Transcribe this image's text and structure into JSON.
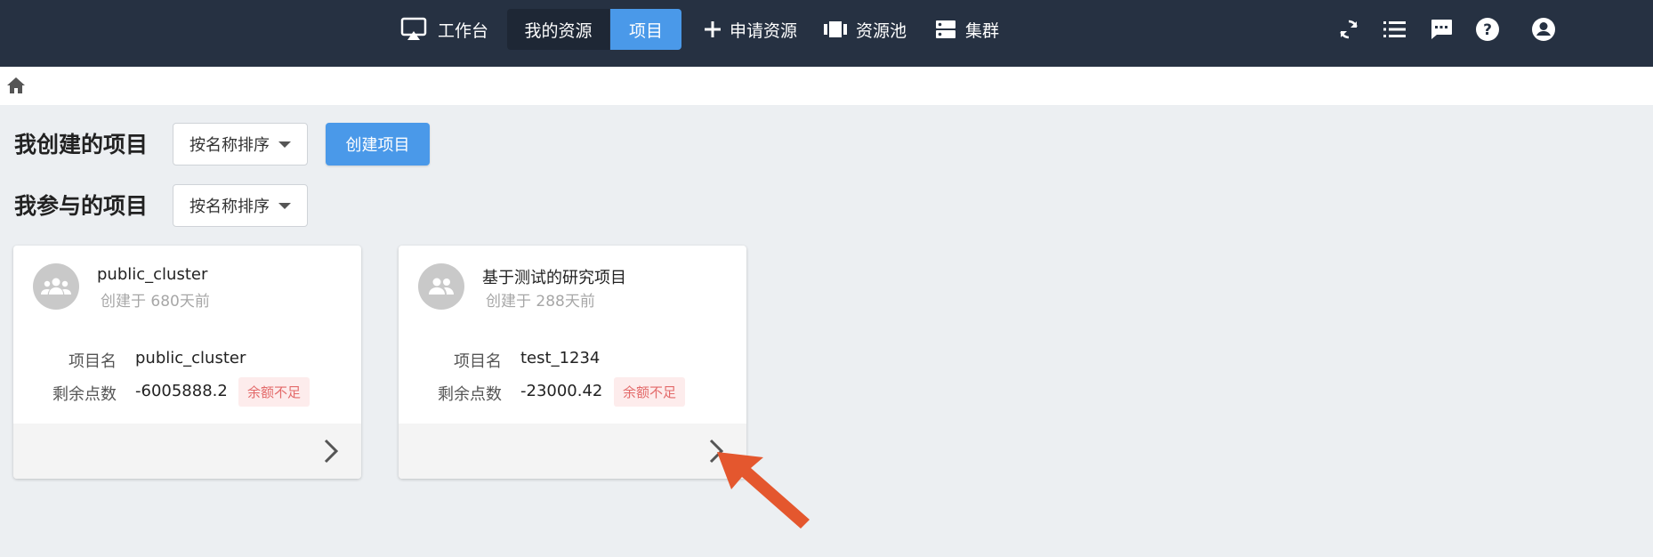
{
  "topbar": {
    "workbench": "工作台",
    "my_resources": "我的资源",
    "projects": "项目",
    "request_resources": "申请资源",
    "resource_pool": "资源池",
    "cluster": "集群",
    "icons": [
      "refresh-icon",
      "list-icon",
      "message-icon",
      "help-icon",
      "account-icon"
    ]
  },
  "created_section": {
    "title": "我创建的项目",
    "sort_label": "按名称排序",
    "create_label": "创建项目"
  },
  "joined_section": {
    "title": "我参与的项目",
    "sort_label": "按名称排序"
  },
  "cards": [
    {
      "title": "public_cluster",
      "created": "创建于 680天前",
      "name_label": "项目名",
      "name_value": "public_cluster",
      "balance_label": "剩余点数",
      "balance_value": "-6005888.2",
      "badge": "余额不足"
    },
    {
      "title": "基于测试的研究项目",
      "created": "创建于 288天前",
      "name_label": "项目名",
      "name_value": "test_1234",
      "balance_label": "剩余点数",
      "balance_value": "-23000.42",
      "badge": "余额不足"
    }
  ],
  "colors": {
    "topbar": "#263142",
    "accent": "#4a99e9",
    "page_bg": "#eceff2",
    "warning_text": "#e36a6a",
    "warning_bg": "#fdecec",
    "annotation_arrow": "#e4572e"
  }
}
